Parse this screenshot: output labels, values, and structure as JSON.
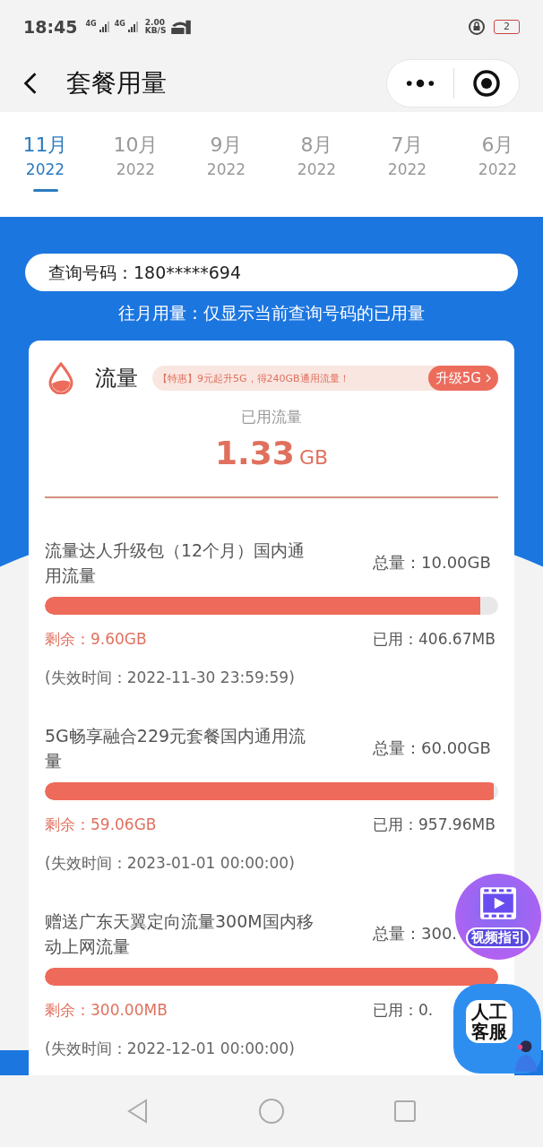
{
  "status_bar": {
    "time": "18:45",
    "network_1": "4G",
    "network_2": "4G",
    "speed_value": "2.00",
    "speed_unit": "KB/S",
    "battery": "2"
  },
  "nav": {
    "title": "套餐用量"
  },
  "tabs": [
    {
      "month": "11月",
      "year": "2022",
      "selected": true
    },
    {
      "month": "10月",
      "year": "2022",
      "selected": false
    },
    {
      "month": "9月",
      "year": "2022",
      "selected": false
    },
    {
      "month": "8月",
      "year": "2022",
      "selected": false
    },
    {
      "month": "7月",
      "year": "2022",
      "selected": false
    },
    {
      "month": "6月",
      "year": "2022",
      "selected": false
    }
  ],
  "query": {
    "number": "查询号码：180*****694",
    "note": "往月用量：仅显示当前查询号码的已用量"
  },
  "data_card": {
    "title": "流量",
    "promo": "【特惠】9元起升5G，得240GB通用流量！",
    "upgrade_button": "升级5G",
    "used_label": "已用流量",
    "used_value": "1.33",
    "used_unit": "GB"
  },
  "packages": [
    {
      "name": "流量达人升级包（12个月）国内通用流量",
      "total": "总量：10.00GB",
      "level": 0.96,
      "remaining": "剩余：9.60GB",
      "used": "已用：406.67MB",
      "expiry": "(失效时间：2022-11-30 23:59:59)"
    },
    {
      "name": "5G畅享融合229元套餐国内通用流量",
      "total": "总量：60.00GB",
      "level": 0.99,
      "remaining": "剩余：59.06GB",
      "used": "已用：957.96MB",
      "expiry": "(失效时间：2023-01-01 00:00:00)"
    },
    {
      "name": "赠送广东天翼定向流量300M国内移动上网流量",
      "total": "总量：300.",
      "level": 1,
      "remaining": "剩余：300.00MB",
      "used": "已用：0.",
      "expiry": "(失效时间：2022-12-01 00:00:00)"
    }
  ],
  "floating": {
    "video_guide": "视频指引",
    "service_line_1": "人工",
    "service_line_2": "客服"
  }
}
